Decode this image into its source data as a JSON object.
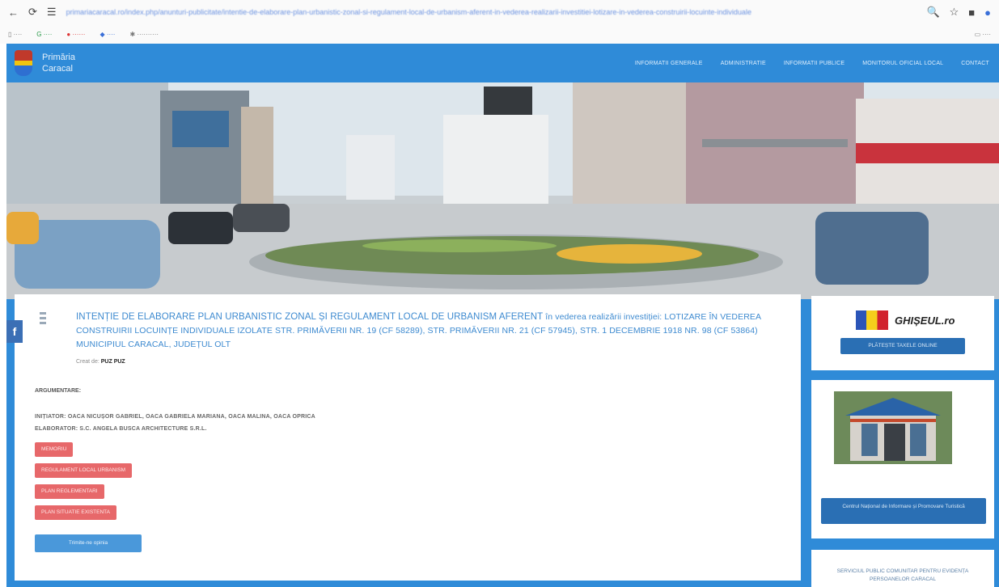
{
  "browser": {
    "url": "primariacaracal.ro/index.php/anunturi-publicitate/intentie-de-elaborare-plan-urbanistic-zonal-si-regulament-local-de-urbanism-aferent-in-vederea-realizarii-investitiei-lotizare-in-vederea-construirii-locuinte-individuale"
  },
  "site": {
    "name_line1": "Primăria",
    "name_line2": "Caracal",
    "menu": [
      "INFORMATII GENERALE",
      "ADMINISTRATIE",
      "INFORMATII PUBLICE",
      "MONITORUL OFICIAL LOCAL",
      "CONTACT"
    ]
  },
  "article": {
    "title_part1": "INTENȚIE DE ELABORARE PLAN URBANISTIC ZONAL ȘI REGULAMENT LOCAL DE URBANISM AFERENT",
    "title_part2": " în vederea realizării investiției: LOTIZARE ÎN VEDEREA CONSTRUIRII LOCUINȚE INDIVIDUALE IZOLATE STR. PRIMĂVERII NR. 19 (CF 58289), STR. PRIMĂVERII NR. 21 (CF 57945), STR. 1 DECEMBRIE 1918 NR. 98 (CF 53864) MUNICIPIUL CARACAL, JUDEȚUL OLT",
    "meta_label": "Creat de:",
    "meta_value": "PUZ PUZ",
    "argument_label": "ARGUMENTARE:",
    "initiator": "INIȚIATOR: OACA NICUȘOR GABRIEL, OACA GABRIELA MARIANA, OACA MALINA, OACA OPRICA",
    "elaborator": "ELABORATOR: S.C. ANGELA BUSCA ARCHITECTURE S.R.L.",
    "buttons": [
      "MEMORIU",
      "REGULAMENT LOCAL URBANISM",
      "PLAN REGLEMENTARI",
      "PLAN SITUATIE EXISTENTA"
    ],
    "link_button": "Trimite-ne opinia"
  },
  "sidebar": {
    "ghiseul_brand": "GHIȘEUL.ro",
    "ghiseul_button": "PLĂTEȘTE TAXELE ONLINE",
    "info_button": "Centrul Național de Informare și Promovare Turistică",
    "bottom_text": "SERVICIUL PUBLIC COMUNITAR PENTRU EVIDENȚA PERSOANELOR CARACAL"
  }
}
